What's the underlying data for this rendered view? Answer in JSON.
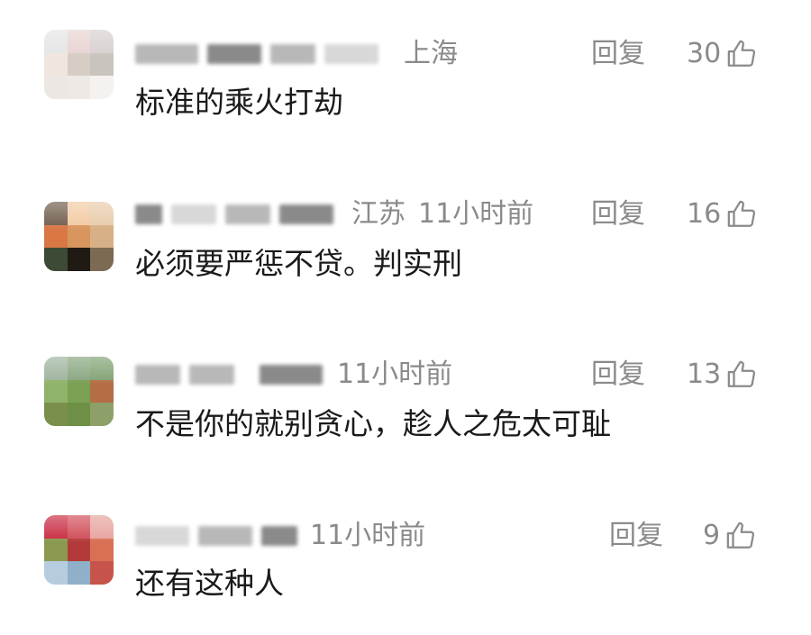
{
  "comments": [
    {
      "location": "上海",
      "time": "",
      "reply_label": "回复",
      "likes": "30",
      "text": "标准的乘火打劫",
      "avatar_colors": [
        "#e4e4e4",
        "#e8d2d2",
        "#d7cfcf",
        "#f0e6df",
        "#d6cec5",
        "#c9c4bd",
        "#ece7e2",
        "#efe9e6",
        "#f4f1ef"
      ]
    },
    {
      "location": "江苏",
      "time": "11小时前",
      "reply_label": "回复",
      "likes": "16",
      "text": "必须要严惩不贷。判实刑",
      "avatar_colors": [
        "#6f5a4b",
        "#f2c9a0",
        "#e8cba9",
        "#d97745",
        "#d8955e",
        "#d7b087",
        "#3d4a36",
        "#201a14",
        "#7c6a52"
      ]
    },
    {
      "location": "",
      "time": "11小时前",
      "reply_label": "回复",
      "likes": "13",
      "text": "不是你的就别贪心，趁人之危太可耻",
      "avatar_colors": [
        "#9cb19b",
        "#86a47d",
        "#7fa070",
        "#8fb36a",
        "#7aa053",
        "#b36e46",
        "#7a8f4b",
        "#6e9046",
        "#8ea06a"
      ]
    },
    {
      "location": "",
      "time": "11小时前",
      "reply_label": "回复",
      "likes": "9",
      "text": "还有这种人",
      "avatar_colors": [
        "#c8283f",
        "#d04a55",
        "#e6a29b",
        "#8a9950",
        "#b23b3a",
        "#d97055",
        "#b6cde0",
        "#8fb0c8",
        "#c7544a"
      ]
    }
  ]
}
